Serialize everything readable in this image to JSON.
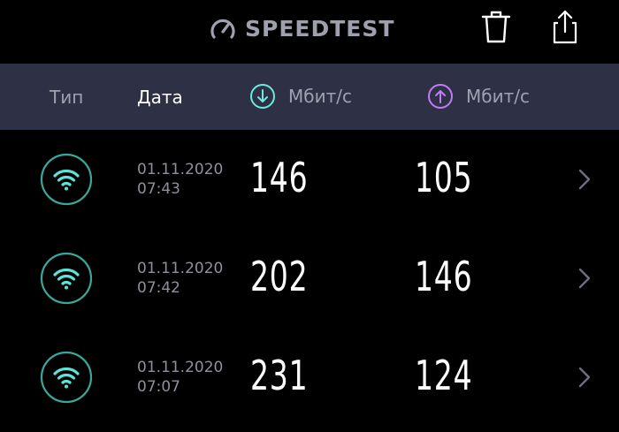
{
  "app": {
    "logo_text": "SPEEDTEST"
  },
  "toolbar": {
    "icons": [
      "trash-icon",
      "share-icon"
    ]
  },
  "columns": {
    "type": "Тип",
    "date": "Дата",
    "download_unit": "Мбит/с",
    "upload_unit": "Мбит/с",
    "download_icon": "arrow-down-circle-icon",
    "upload_icon": "arrow-up-circle-icon"
  },
  "colors": {
    "background": "#000000",
    "header_bar": "#2e3046",
    "logo": "#9fa0ad",
    "download_accent": "#6ee7dc",
    "upload_accent": "#c07cf5",
    "wifi_accent": "#5fe3d8",
    "wifi_ring": "#3aa79d",
    "muted_text": "#8f909e"
  },
  "results": [
    {
      "connection_icon": "wifi-icon",
      "date": "01.11.2020",
      "time": "07:43",
      "download": "146",
      "upload": "105"
    },
    {
      "connection_icon": "wifi-icon",
      "date": "01.11.2020",
      "time": "07:42",
      "download": "202",
      "upload": "146"
    },
    {
      "connection_icon": "wifi-icon",
      "date": "01.11.2020",
      "time": "07:07",
      "download": "231",
      "upload": "124"
    }
  ]
}
